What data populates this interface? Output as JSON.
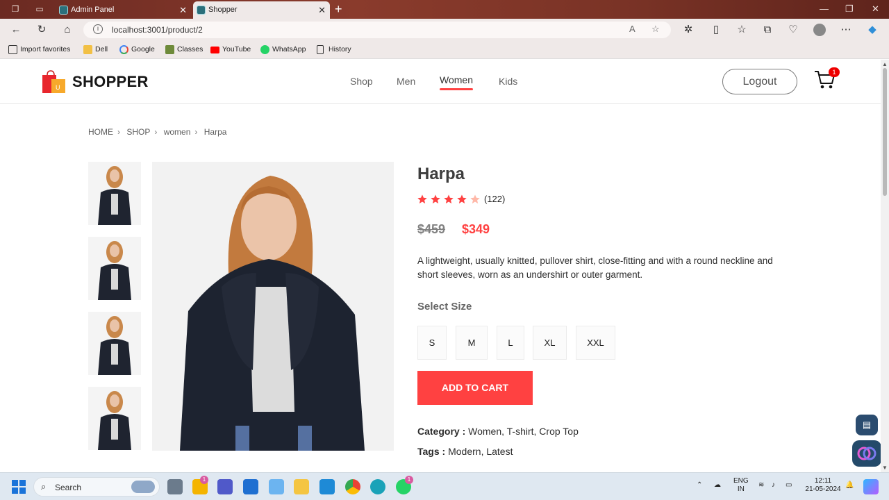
{
  "browser": {
    "tabs": [
      {
        "title": "Admin Panel",
        "active": false
      },
      {
        "title": "Shopper",
        "active": true
      }
    ],
    "url": "localhost:3001/product/2",
    "bookmarks": [
      "Import favorites",
      "Dell",
      "Google",
      "Classes",
      "YouTube",
      "WhatsApp",
      "History"
    ]
  },
  "header": {
    "brand": "SHOPPER",
    "menu": [
      "Shop",
      "Men",
      "Women",
      "Kids"
    ],
    "active_menu": "Women",
    "logout_label": "Logout",
    "cart_count": "1"
  },
  "breadcrumb": [
    "HOME",
    "SHOP",
    "women",
    "Harpa"
  ],
  "product": {
    "name": "Harpa",
    "rating_stars": 4,
    "rating_max": 5,
    "review_count": "(122)",
    "old_price": "$459",
    "new_price": "$349",
    "description": "A lightweight, usually knitted, pullover shirt, close-fitting and with a round neckline and short sleeves, worn as an undershirt or outer garment.",
    "select_size_label": "Select Size",
    "sizes": [
      "S",
      "M",
      "L",
      "XL",
      "XXL"
    ],
    "add_to_cart_label": "ADD TO CART",
    "category_label": "Category :",
    "category_value": "Women, T-shirt, Crop Top",
    "tags_label": "Tags :",
    "tags_value": "Modern, Latest"
  },
  "taskbar": {
    "search_label": "Search",
    "lang_line1": "ENG",
    "lang_line2": "IN",
    "time": "12:11",
    "date": "21-05-2024",
    "badge_1": "1",
    "badge_2": "1"
  },
  "colors": {
    "accent": "#ff4141",
    "star": "#ff4141",
    "star_empty": "#ffb8a8"
  }
}
